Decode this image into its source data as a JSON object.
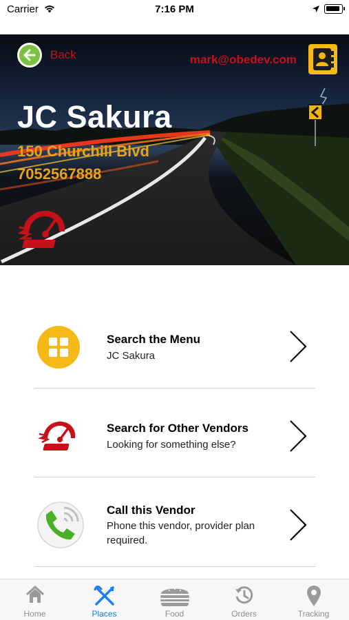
{
  "status_bar": {
    "carrier": "Carrier",
    "time": "7:16 PM"
  },
  "header": {
    "back_label": "Back",
    "user_email": "mark@obedev.com"
  },
  "vendor": {
    "name": "JC Sakura",
    "address": "150 Churchill Blvd",
    "phone": "7052567888"
  },
  "actions": [
    {
      "title": "Search the Menu",
      "subtitle": "JC Sakura",
      "icon": "menu-grid-icon"
    },
    {
      "title": "Search for Other Vendors",
      "subtitle": "Looking for something else?",
      "icon": "speed-logo-icon"
    },
    {
      "title": "Call this Vendor",
      "subtitle": "Phone this vendor, provider plan required.",
      "icon": "phone-call-icon"
    }
  ],
  "tabs": [
    {
      "label": "Home",
      "icon": "home-icon",
      "active": false
    },
    {
      "label": "Places",
      "icon": "fork-knife-icon",
      "active": true
    },
    {
      "label": "Food",
      "icon": "burger-icon",
      "active": false
    },
    {
      "label": "Orders",
      "icon": "history-icon",
      "active": false
    },
    {
      "label": "Tracking",
      "icon": "map-pin-icon",
      "active": false
    }
  ],
  "colors": {
    "accent_red": "#c4121a",
    "accent_gold": "#e8a319",
    "tab_active": "#1a7ff0",
    "tab_inactive": "#8e8e93",
    "menu_icon_yellow": "#f4b916",
    "back_green": "#7cc242"
  }
}
